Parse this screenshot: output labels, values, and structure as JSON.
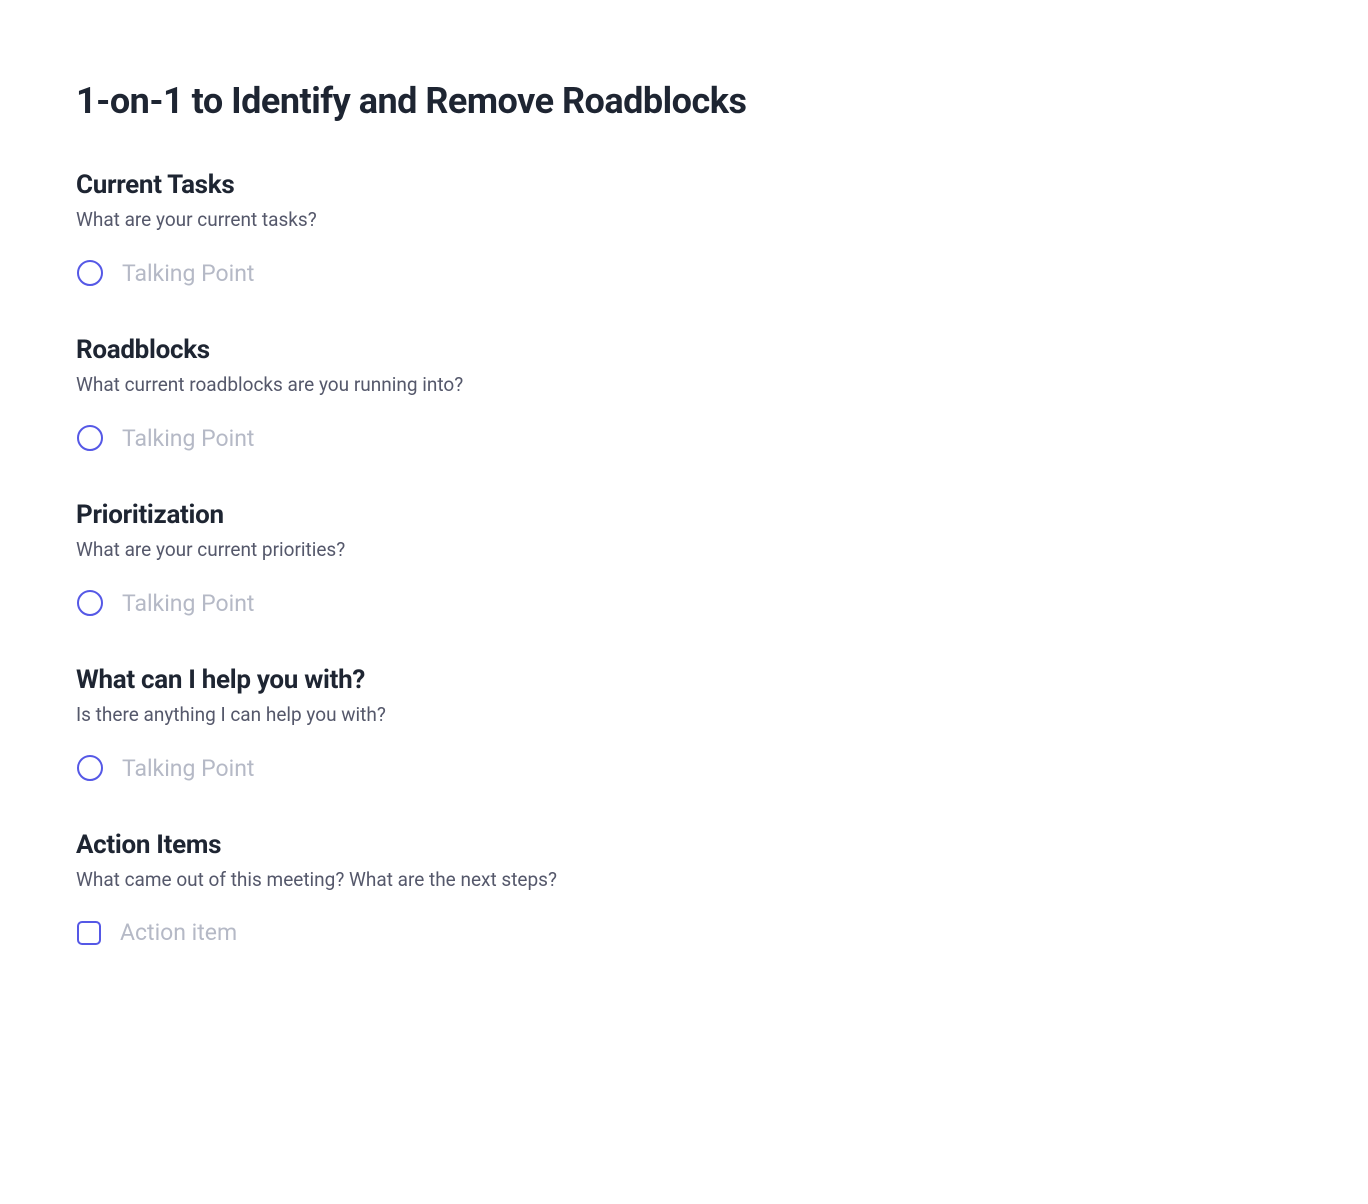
{
  "title": "1-on-1 to Identify and Remove Roadblocks",
  "sections": [
    {
      "heading": "Current Tasks",
      "prompt": "What are your current tasks?",
      "item_type": "circle",
      "placeholder": "Talking Point"
    },
    {
      "heading": "Roadblocks",
      "prompt": "What current roadblocks are you running into?",
      "item_type": "circle",
      "placeholder": "Talking Point"
    },
    {
      "heading": "Prioritization",
      "prompt": "What are your current priorities?",
      "item_type": "circle",
      "placeholder": "Talking Point"
    },
    {
      "heading": "What can I help you with?",
      "prompt": "Is there anything I can help you with?",
      "item_type": "circle",
      "placeholder": "Talking Point"
    },
    {
      "heading": "Action Items",
      "prompt": "What came out of this meeting? What are the next steps?",
      "item_type": "square",
      "placeholder": "Action item"
    }
  ]
}
